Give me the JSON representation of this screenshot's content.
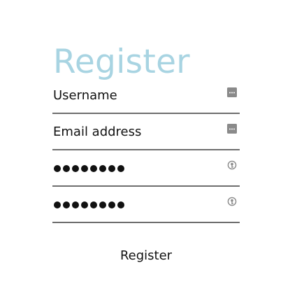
{
  "page": {
    "title": "Register"
  },
  "form": {
    "username": {
      "value": "Username",
      "icon": "autofill-card-icon"
    },
    "email": {
      "value": "Email address",
      "icon": "autofill-card-icon"
    },
    "password": {
      "masked_length": 8,
      "icon": "password-key-icon"
    },
    "confirm_password": {
      "masked_length": 8,
      "icon": "password-key-icon"
    },
    "submit_label": "Register"
  },
  "colors": {
    "title": "#a8d4e2",
    "underline": "#6e6e6e",
    "icon": "#8a8a8a"
  }
}
